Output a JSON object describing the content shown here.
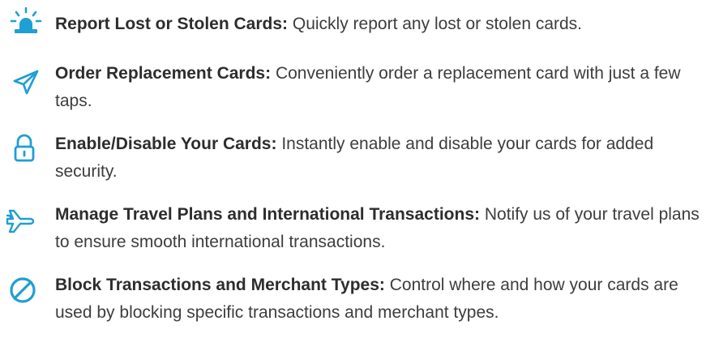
{
  "accent_color": "#1f9fd3",
  "features": [
    {
      "icon": "alarm-siren-icon",
      "title": "Report Lost or Stolen Cards:",
      "description": "Quickly report any lost or stolen cards."
    },
    {
      "icon": "send-paper-plane-icon",
      "title": "Order Replacement Cards:",
      "description": "Conveniently order a replacement card with just a few taps."
    },
    {
      "icon": "padlock-icon",
      "title": "Enable/Disable Your Cards:",
      "description": "Instantly enable and disable your cards for added security."
    },
    {
      "icon": "airplane-icon",
      "title": "Manage Travel Plans and International Transactions:",
      "description": "Notify us of your travel plans to ensure smooth international transactions."
    },
    {
      "icon": "block-icon",
      "title": "Block Transactions and Merchant Types:",
      "description": "Control where and how your cards are used by blocking specific transactions and merchant types."
    }
  ]
}
